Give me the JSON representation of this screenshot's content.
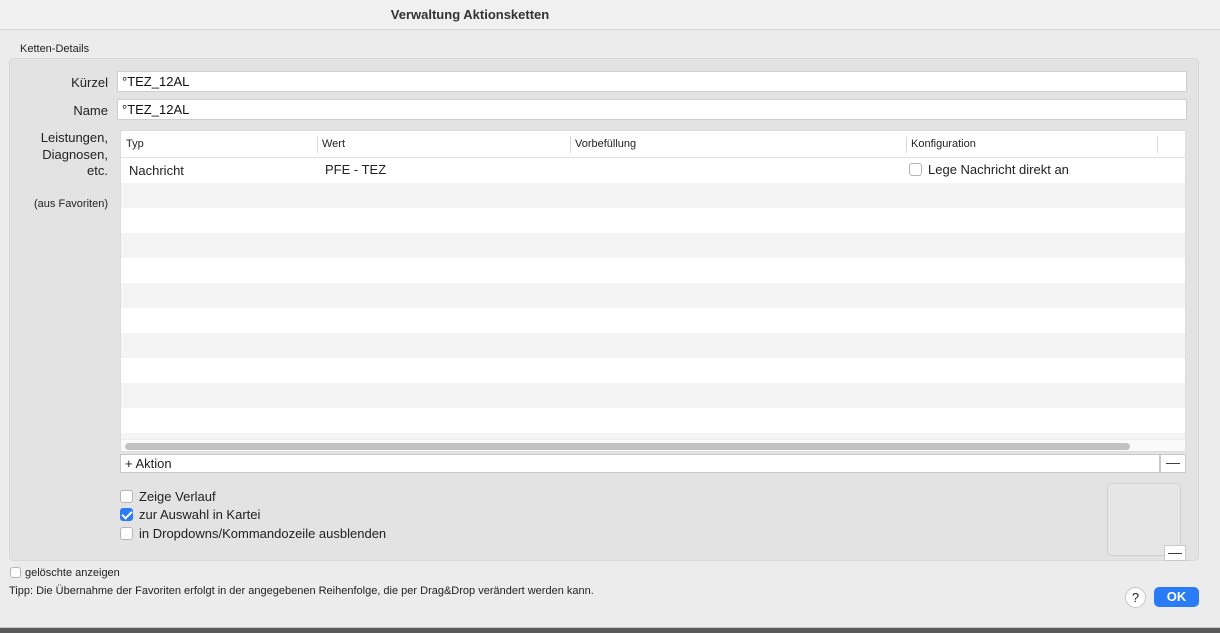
{
  "window": {
    "title": "Verwaltung Aktionsketten"
  },
  "section": {
    "label": "Ketten-Details"
  },
  "fields": {
    "kuerzel_label": "Kürzel",
    "kuerzel_value": "°TEZ_12AL",
    "name_label": "Name",
    "name_value": "°TEZ_12AL",
    "items_label": [
      "Leistungen,",
      "Diagnosen,",
      "etc."
    ],
    "favorites_note": "(aus Favoriten)"
  },
  "table": {
    "columns": [
      "Typ",
      "Wert",
      "Vorbefüllung",
      "Konfiguration"
    ],
    "rows": [
      {
        "typ": "Nachricht",
        "wert": "PFE - TEZ",
        "vorbefuellung": "",
        "konfiguration": "Lege Nachricht direkt an",
        "konfiguration_checked": false
      }
    ]
  },
  "actions": {
    "add_label": "+ Aktion",
    "remove_label": "—"
  },
  "options": [
    {
      "label": "Zeige Verlauf",
      "checked": false
    },
    {
      "label": "zur Auswahl in Kartei",
      "checked": true
    },
    {
      "label": "in Dropdowns/Kommandozeile ausblenden",
      "checked": false
    }
  ],
  "preview": {
    "remove_label": "—"
  },
  "footer": {
    "show_deleted_label": "gelöschte anzeigen",
    "show_deleted_checked": false,
    "tip": "Tipp: Die Übernahme der Favoriten erfolgt in der angegebenen Reihenfolge, die per Drag&Drop verändert werden kann.",
    "help_label": "?",
    "ok_label": "OK"
  },
  "colors": {
    "accent": "#2a7bf6",
    "background": "#ececec"
  }
}
